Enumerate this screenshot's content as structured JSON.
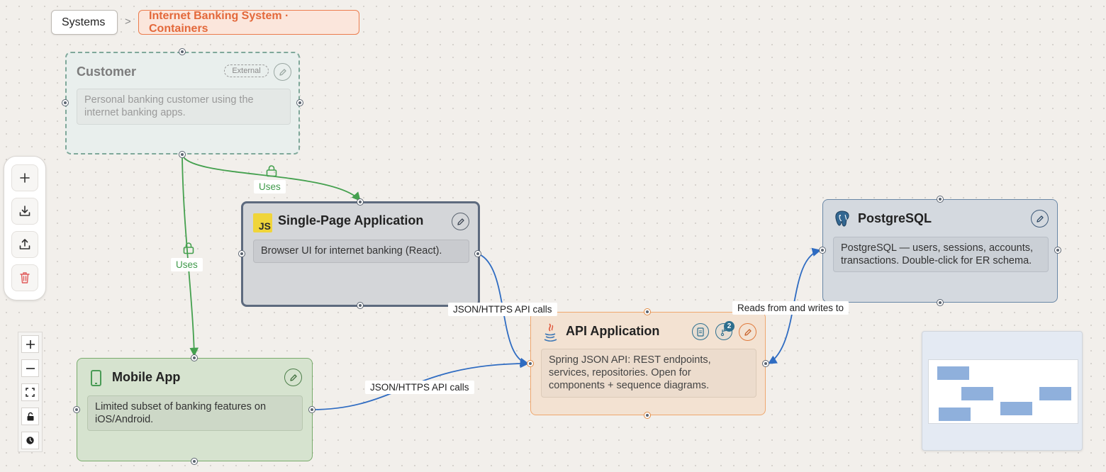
{
  "breadcrumb": {
    "root": "Systems",
    "separator": ">",
    "current": "Internet Banking System · Containers"
  },
  "nodes": {
    "customer": {
      "title": "Customer",
      "badge": "External",
      "description": "Personal banking customer using the internet banking apps.",
      "icon": "pencil-icon"
    },
    "spa": {
      "title": "Single-Page Application",
      "tech_icon_text": "JS",
      "description": "Browser UI for internet banking (React).",
      "icon": "pencil-icon"
    },
    "mobile": {
      "title": "Mobile App",
      "description": "Limited subset of banking features on iOS/Android.",
      "icon": "phone-icon"
    },
    "api": {
      "title": "API Application",
      "description": "Spring JSON API: REST endpoints, services, repositories. Open for components + sequence diagrams.",
      "flow_count": "2",
      "icon": "java-icon"
    },
    "postgres": {
      "title": "PostgreSQL",
      "description": "PostgreSQL — users, sessions, accounts, transactions. Double-click for ER schema.",
      "icon": "postgres-icon"
    }
  },
  "edges": {
    "customer_spa": "Uses",
    "customer_mobile": "Uses",
    "spa_api": "JSON/HTTPS API calls",
    "mobile_api": "JSON/HTTPS API calls",
    "api_postgres": "Reads from and writes to"
  },
  "colors": {
    "edge_green": "#44a04e",
    "edge_blue": "#2f6cc2",
    "accent_orange": "#ec7c4d"
  },
  "toolbar": [
    "plus-icon",
    "download-icon",
    "upload-icon",
    "trash-icon"
  ],
  "zoom_controls": [
    "zoom-in-icon",
    "zoom-out-icon",
    "fit-view-icon",
    "lock-icon",
    "reset-icon"
  ]
}
